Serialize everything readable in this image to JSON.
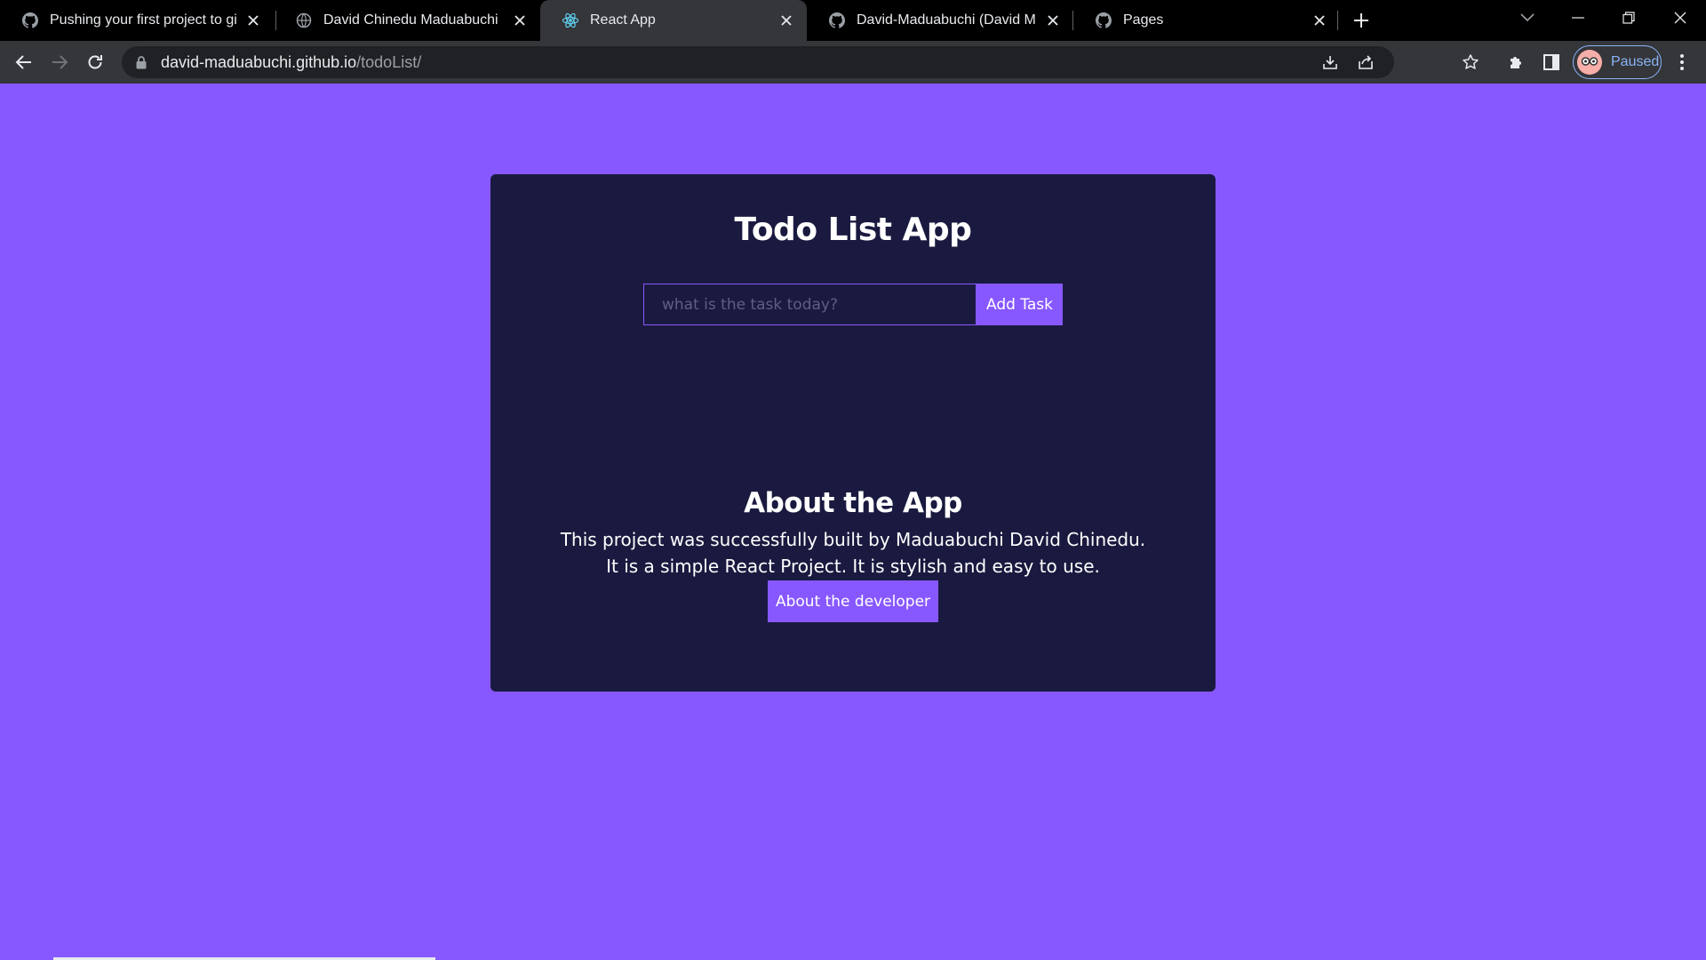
{
  "browser": {
    "tabs": [
      {
        "title": "Pushing your first project to gith",
        "favicon": "github-icon"
      },
      {
        "title": "David Chinedu Maduabuchi | De",
        "favicon": "globe-icon"
      },
      {
        "title": "React App",
        "favicon": "react-icon",
        "active": true
      },
      {
        "title": "David-Maduabuchi (David Madu",
        "favicon": "github-icon"
      },
      {
        "title": "Pages",
        "favicon": "github-icon"
      }
    ],
    "address": {
      "host": "david-maduabuchi.github.io",
      "path": "/todoList/"
    },
    "profile_status": "Paused",
    "colors": {
      "chrome_dark": "#35363a",
      "tabstrip": "#000000",
      "profile_accent": "#8ab4f8"
    }
  },
  "app": {
    "title": "Todo List App",
    "input_placeholder": "what is the task today?",
    "add_button": "Add Task",
    "about": {
      "heading": "About the App",
      "line1": "This project was successfully built by Maduabuchi David Chinedu.",
      "line2": "It is a simple React Project. It is stylish and easy to use.",
      "button": "About the developer"
    },
    "colors": {
      "page_bg": "#8758ff",
      "card_bg": "#1a1a40",
      "accent": "#8758ff"
    }
  }
}
